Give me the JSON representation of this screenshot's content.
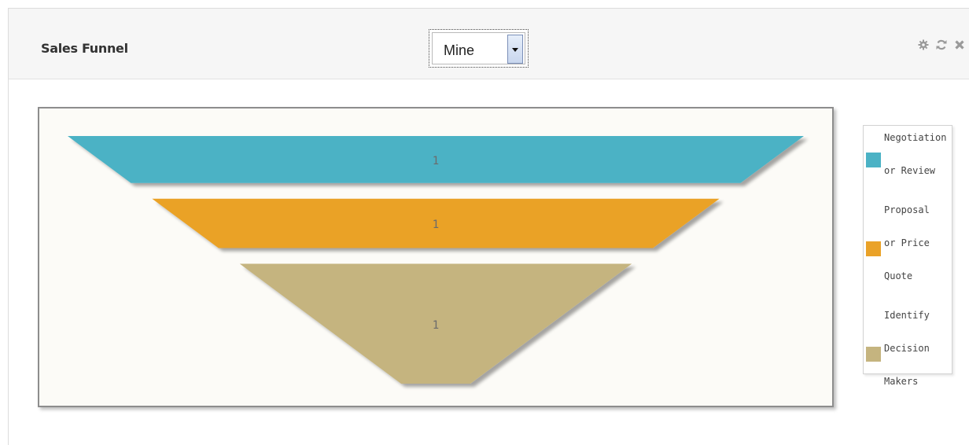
{
  "header": {
    "title": "Sales Funnel",
    "filter_value": "Mine",
    "icons": [
      "gear-icon",
      "refresh-icon",
      "close-icon"
    ]
  },
  "chart_data": {
    "type": "funnel",
    "title": "",
    "stages": [
      {
        "label": "Negotiation or Review",
        "value": 1,
        "color": "#4bb2c5"
      },
      {
        "label": "Proposal or Price Quote",
        "value": 1,
        "color": "#eaa228"
      },
      {
        "label": "Identify Decision Makers",
        "value": 1,
        "color": "#c5b47f"
      }
    ],
    "legend_position": "right",
    "colors": {
      "background": "#fcfbf7",
      "label": "#6b6b6b"
    }
  },
  "legend": {
    "items": [
      {
        "lines": [
          "Negotiation",
          "or Review"
        ],
        "color": "#4bb2c5"
      },
      {
        "lines": [
          "Proposal",
          "or Price",
          "Quote"
        ],
        "color": "#eaa228"
      },
      {
        "lines": [
          "Identify",
          "Decision",
          "Makers"
        ],
        "color": "#c5b47f"
      }
    ]
  }
}
